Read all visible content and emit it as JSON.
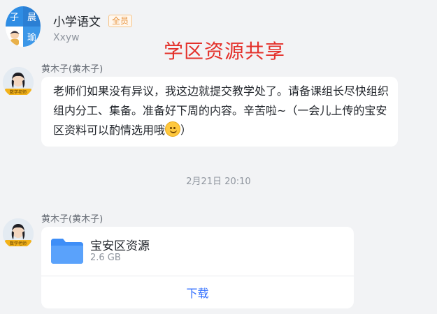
{
  "header": {
    "group_name": "小学语文",
    "member_badge": "全员",
    "subtitle": "Xxyw",
    "avatar_chars": [
      "子",
      "晨",
      "",
      "瑜"
    ]
  },
  "banner": "学区资源共享",
  "messages": [
    {
      "sender": "黄木子(黄木子)",
      "avatar_tag": "数学老师",
      "text": "老师们如果没有异议，我这边就提交教学处了。请备课组长尽快组织组内分工、集备。准备好下周的内容。辛苦啦~（一会儿上传的宝安区资料可以酌情选用哦",
      "text_end": "）",
      "emoji": "smile-emoji"
    },
    {
      "timestamp": "2月21日 20:10"
    },
    {
      "sender": "黄木子(黄木子)",
      "avatar_tag": "数学老师",
      "file": {
        "name": "宝安区资源",
        "size": "2.6 GB",
        "icon": "folder-icon",
        "action": "下载"
      }
    }
  ],
  "colors": {
    "background": "#f2f3f5",
    "banner": "#e4312b",
    "link": "#3370ff",
    "folder": "#3e8ef7"
  }
}
